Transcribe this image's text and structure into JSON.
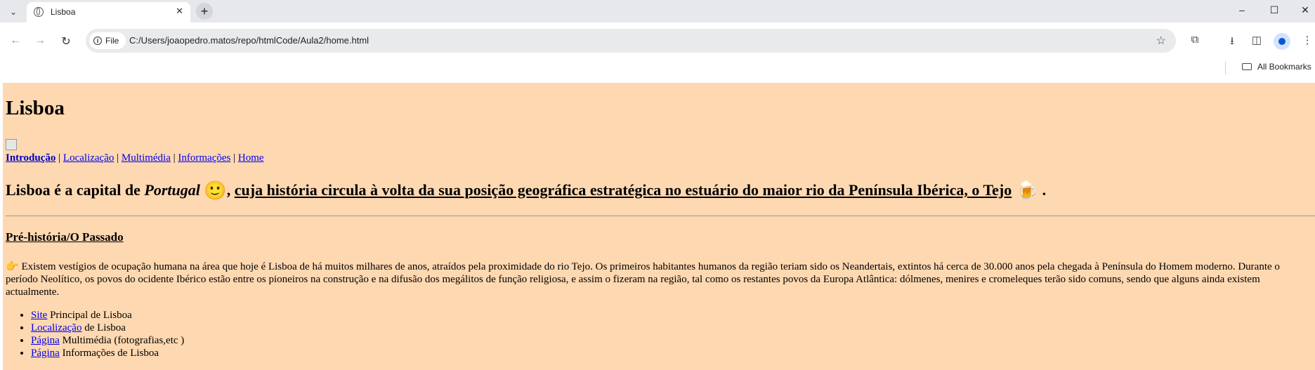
{
  "browser": {
    "tab": {
      "title": "Lisboa",
      "close": "✕"
    },
    "tab_search": "⌄",
    "new_tab": "+",
    "window": {
      "minimize": "–",
      "maximize": "☐",
      "close": "✕"
    },
    "nav": {
      "back": "←",
      "forward": "→",
      "reload": "↻"
    },
    "address": {
      "chip": "File",
      "url": "C:/Users/joaopedro.matos/repo/htmlCode/Aula2/home.html"
    },
    "icons": {
      "star": "☆",
      "extensions": "⧉",
      "download": "⭳",
      "sidepanel": "◫",
      "menu": "⋮"
    },
    "bookmarks": {
      "all_bookmarks": "All Bookmarks"
    }
  },
  "page": {
    "title": "Lisboa",
    "menu": [
      {
        "label": "Introdução",
        "bold": true
      },
      {
        "label": "Localização"
      },
      {
        "label": "Multimédia"
      },
      {
        "label": "Informações"
      },
      {
        "label": "Home"
      }
    ],
    "menu_separator": " | ",
    "lead": {
      "part1": "Lisboa é a capital de ",
      "country": "Portugal",
      "emoji1": "🙂",
      "comma": ", ",
      "underlined": "cuja história circula à volta da sua posição geográfica estratégica no estuário do maior rio da Península Ibérica, o Tejo",
      "emoji2": "🍺",
      "end": " ."
    },
    "section_title": "Pré-história/O Passado",
    "paragraph_emoji": "👉",
    "paragraph": "Existem vestígios de ocupação humana na área que hoje é Lisboa de há muitos milhares de anos, atraídos pela proximidade do rio Tejo. Os primeiros habitantes humanos da região teriam sido os Neandertais, extintos há cerca de 30.000 anos pela chegada à Península do Homem moderno. Durante o período Neolítico, os povos do ocidente Ibérico estão entre os pioneiros na construção e na difusão dos megálitos de função religiosa, e assim o fizeram na região, tal como os restantes povos da Europa Atlântica: dólmenes, menires e cromeleques terão sido comuns, sendo que alguns ainda existem actualmente.",
    "links": [
      {
        "link": "Site",
        "text": " Principal de Lisboa"
      },
      {
        "link": "Localização",
        "text": " de Lisboa"
      },
      {
        "link": "Página",
        "text": " Multimédia (fotografias,etc )"
      },
      {
        "link": "Página",
        "text": " Informações de Lisboa"
      }
    ]
  }
}
